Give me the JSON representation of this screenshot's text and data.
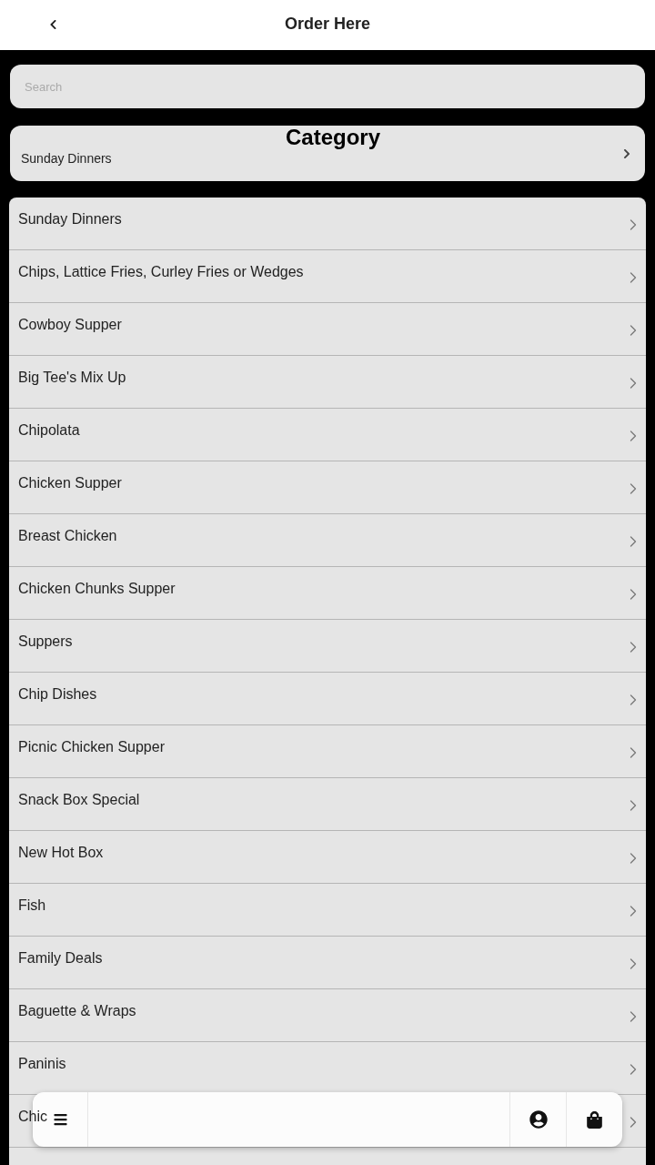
{
  "header": {
    "title": "Order Here"
  },
  "search": {
    "placeholder": "Search"
  },
  "category": {
    "title": "Category",
    "value": "Sunday Dinners"
  },
  "categories": [
    {
      "label": "Sunday Dinners"
    },
    {
      "label": "Chips, Lattice Fries, Curley Fries or Wedges"
    },
    {
      "label": "Cowboy Supper"
    },
    {
      "label": "Big Tee's Mix Up"
    },
    {
      "label": "Chipolata"
    },
    {
      "label": "Chicken Supper"
    },
    {
      "label": "Breast Chicken"
    },
    {
      "label": "Chicken Chunks Supper"
    },
    {
      "label": "Suppers"
    },
    {
      "label": "Chip Dishes"
    },
    {
      "label": "Picnic Chicken Supper"
    },
    {
      "label": "Snack Box Special"
    },
    {
      "label": "New Hot Box"
    },
    {
      "label": "Fish"
    },
    {
      "label": "Family Deals"
    },
    {
      "label": "Baguette & Wraps"
    },
    {
      "label": "Paninis"
    },
    {
      "label": "Chic"
    }
  ]
}
